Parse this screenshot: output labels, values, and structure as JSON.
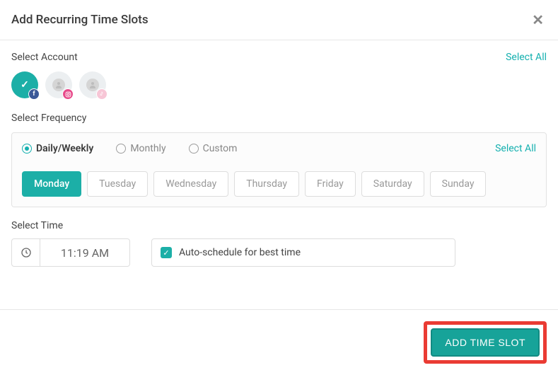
{
  "header": {
    "title": "Add Recurring Time Slots"
  },
  "account": {
    "label": "Select Account",
    "select_all": "Select All",
    "items": [
      {
        "network": "facebook",
        "selected": true
      },
      {
        "network": "instagram",
        "selected": false
      },
      {
        "network": "tiktok",
        "selected": false
      }
    ]
  },
  "frequency": {
    "label": "Select Frequency",
    "select_all": "Select All",
    "options": [
      {
        "label": "Daily/Weekly",
        "checked": true
      },
      {
        "label": "Monthly",
        "checked": false
      },
      {
        "label": "Custom",
        "checked": false
      }
    ],
    "days": [
      {
        "label": "Monday",
        "selected": true
      },
      {
        "label": "Tuesday",
        "selected": false
      },
      {
        "label": "Wednesday",
        "selected": false
      },
      {
        "label": "Thursday",
        "selected": false
      },
      {
        "label": "Friday",
        "selected": false
      },
      {
        "label": "Saturday",
        "selected": false
      },
      {
        "label": "Sunday",
        "selected": false
      }
    ]
  },
  "time": {
    "label": "Select Time",
    "value": "11:19 AM",
    "auto_label": "Auto-schedule for best time",
    "auto_checked": true
  },
  "footer": {
    "add_label": "ADD TIME SLOT"
  }
}
